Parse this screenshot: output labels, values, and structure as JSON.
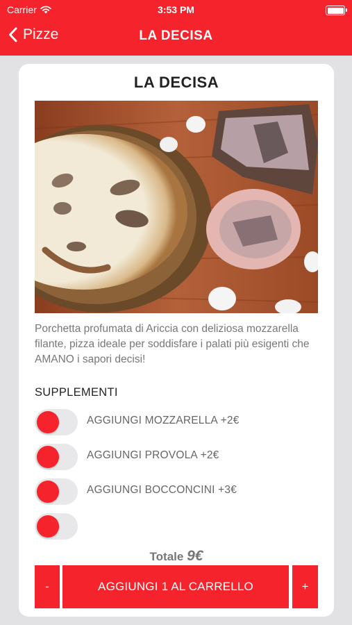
{
  "status_bar": {
    "carrier": "Carrier",
    "time": "3:53 PM"
  },
  "nav": {
    "back_label": "Pizze",
    "title": "LA DECISA"
  },
  "product": {
    "title": "LA DECISA",
    "description": "Porchetta profumata di Ariccia con deliziosa mozzarella filante, pizza ideale per soddisfare i palati più esigenti che AMANO i sapori decisi!"
  },
  "supplements": {
    "title": "SUPPLEMENTI",
    "items": [
      {
        "label": "AGGIUNGI MOZZARELLA +2€",
        "on": false
      },
      {
        "label": "AGGIUNGI PROVOLA +2€",
        "on": false
      },
      {
        "label": "AGGIUNGI BOCCONCINI +3€",
        "on": false
      },
      {
        "label": "",
        "on": false
      }
    ]
  },
  "total": {
    "label": "Totale",
    "amount": "9€"
  },
  "actions": {
    "minus_label": "-",
    "add_label": "AGGIUNGI 1 AL CARRELLO",
    "plus_label": "+"
  },
  "colors": {
    "accent": "#f5232b",
    "background": "#e2e2e4"
  }
}
